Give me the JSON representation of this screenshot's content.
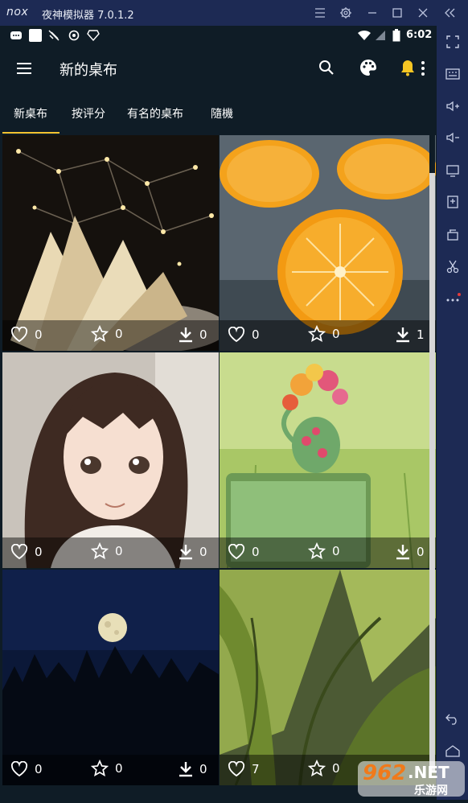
{
  "window": {
    "title": "夜神模拟器 7.0.1.2",
    "logo": "nox"
  },
  "statusbar": {
    "time": "6:02"
  },
  "appbar": {
    "title": "新的桌布"
  },
  "tabs": [
    {
      "label": "新桌布",
      "active": true
    },
    {
      "label": "按评分"
    },
    {
      "label": "有名的桌布"
    },
    {
      "label": "隨機"
    }
  ],
  "tiles": [
    {
      "subject": "open-book-with-lights",
      "likes": "0",
      "stars": "0",
      "downloads": "0"
    },
    {
      "subject": "sliced-oranges",
      "likes": "0",
      "stars": "0",
      "downloads": "1"
    },
    {
      "subject": "anime-girl",
      "likes": "0",
      "stars": "0",
      "downloads": "0"
    },
    {
      "subject": "flower-vase-on-suitcase",
      "likes": "0",
      "stars": "0",
      "downloads": "0"
    },
    {
      "subject": "moon-over-forest",
      "likes": "0",
      "stars": "0",
      "downloads": "0"
    },
    {
      "subject": "banana-leaves",
      "likes": "7",
      "stars": "0",
      "downloads": ""
    }
  ],
  "watermark": {
    "brand": "962",
    "suffix": ".NET",
    "tagline": "乐游网"
  },
  "colors": {
    "accent": "#f2c230",
    "background": "#0f1c26",
    "emulator_frame": "#1d2a54",
    "bell": "#f6c623"
  }
}
